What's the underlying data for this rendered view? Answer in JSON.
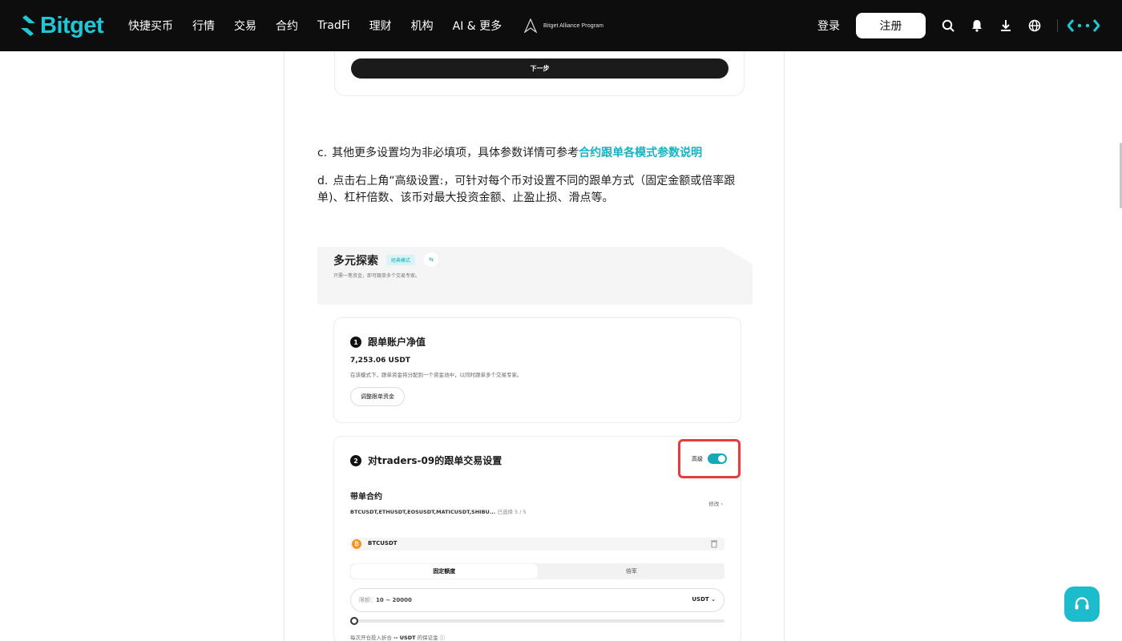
{
  "header": {
    "logo_text": "Bitget",
    "nav": [
      "快捷买币",
      "行情",
      "交易",
      "合约",
      "TradFi",
      "理财",
      "机构",
      "AI & 更多"
    ],
    "alliance_text": "Bitget Alliance Program",
    "login": "登录",
    "register": "注册",
    "tools": [
      "search-icon",
      "bell-icon",
      "download-icon",
      "globe-icon"
    ],
    "accent_color": "#1dc9d8"
  },
  "article": {
    "next_button": "下一步",
    "para_c_mark": "c.",
    "para_c_text": "其他更多设置均为非必填项，具体参数详情可参考",
    "para_c_link": "合约跟单各模式参数说明",
    "para_d_mark": "d.",
    "para_d_text": "点击右上角“高级设置:，可针对每个币对设置不同的跟单方式（固定金额或倍率跟单)、杠杆倍数、该币对最大投资金额、止盈止损、滑点等。",
    "link_color": "#16b3c4"
  },
  "screenshot": {
    "title": "多元探索",
    "badge": "经典模式",
    "subtitle": "只需一笔资金，即可跟单多个交易专家。",
    "card1": {
      "step": "1",
      "title": "跟单账户净值",
      "value": "7,253.06 USDT",
      "desc": "在该模式下，跟单资金将分配到一个资金池中，以同时跟单多个交易专家。",
      "button": "调整跟单资金"
    },
    "card2": {
      "step": "2",
      "title": "对traders-09的跟单交易设置",
      "advanced_label": "高级",
      "section": "带单合约",
      "pairs": "BTCUSDT,ETHUSDT,EOSUSDT,MATICUSDT,SHIBU...",
      "selected": "已选择 5 / 5",
      "edit": "修改",
      "coin": "BTCUSDT",
      "tabs": [
        "固定额度",
        "倍率"
      ],
      "limit_label": "限额：",
      "limit_range": "10 ~ 20000",
      "unit": "USDT",
      "footnote_prefix": "每次开仓投入折合",
      "footnote_value": "-- USDT",
      "footnote_suffix": "的保证金"
    }
  },
  "support_icon": "headset-icon"
}
